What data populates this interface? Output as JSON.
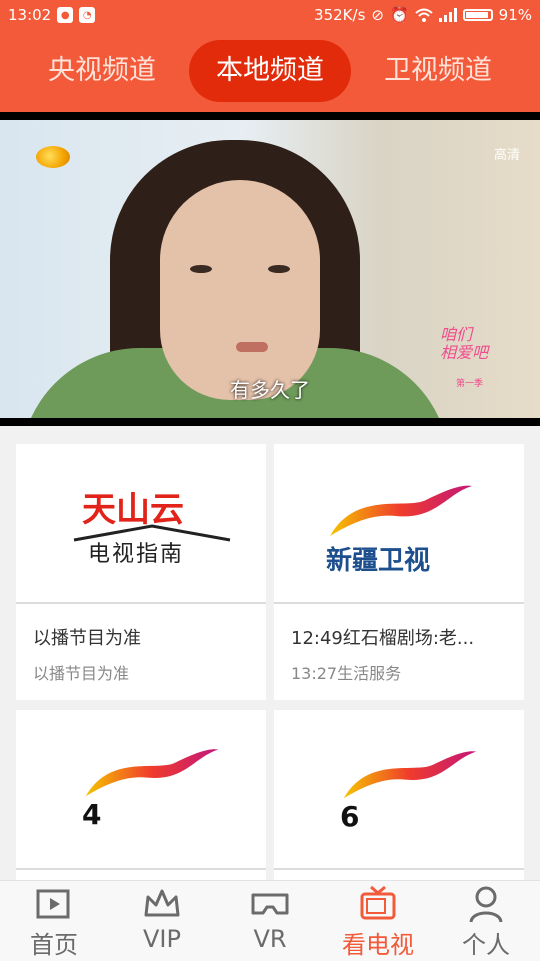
{
  "status_bar": {
    "time": "13:02",
    "net_speed": "352K/s",
    "battery_pct": "91%"
  },
  "tabs": [
    {
      "label": "央视频道"
    },
    {
      "label": "本地频道",
      "active": true
    },
    {
      "label": "卫视频道"
    }
  ],
  "player": {
    "quality": "高清",
    "subtitle": "有多久了",
    "show_logo": "咱们\n相爱吧",
    "show_logo_sub": "第一季"
  },
  "channels": [
    {
      "logo_line1": "天山云",
      "logo_line2": "电视指南",
      "title": "以播节目为准",
      "subtitle": "以播节目为准"
    },
    {
      "logo_text": "新疆卫视",
      "title": "12:49红石榴剧场:老...",
      "subtitle": "13:27生活服务"
    },
    {
      "logo_number": "4"
    },
    {
      "logo_number": "6"
    }
  ],
  "bottom_nav": [
    {
      "label": "首页",
      "icon": "play-square-icon"
    },
    {
      "label": "VIP",
      "icon": "crown-icon"
    },
    {
      "label": "VR",
      "icon": "vr-goggles-icon"
    },
    {
      "label": "看电视",
      "icon": "tv-icon",
      "active": true
    },
    {
      "label": "个人",
      "icon": "user-icon"
    }
  ],
  "colors": {
    "accent": "#f25a3a",
    "active_tab": "#e22b0a",
    "logo_red": "#e2231a"
  }
}
